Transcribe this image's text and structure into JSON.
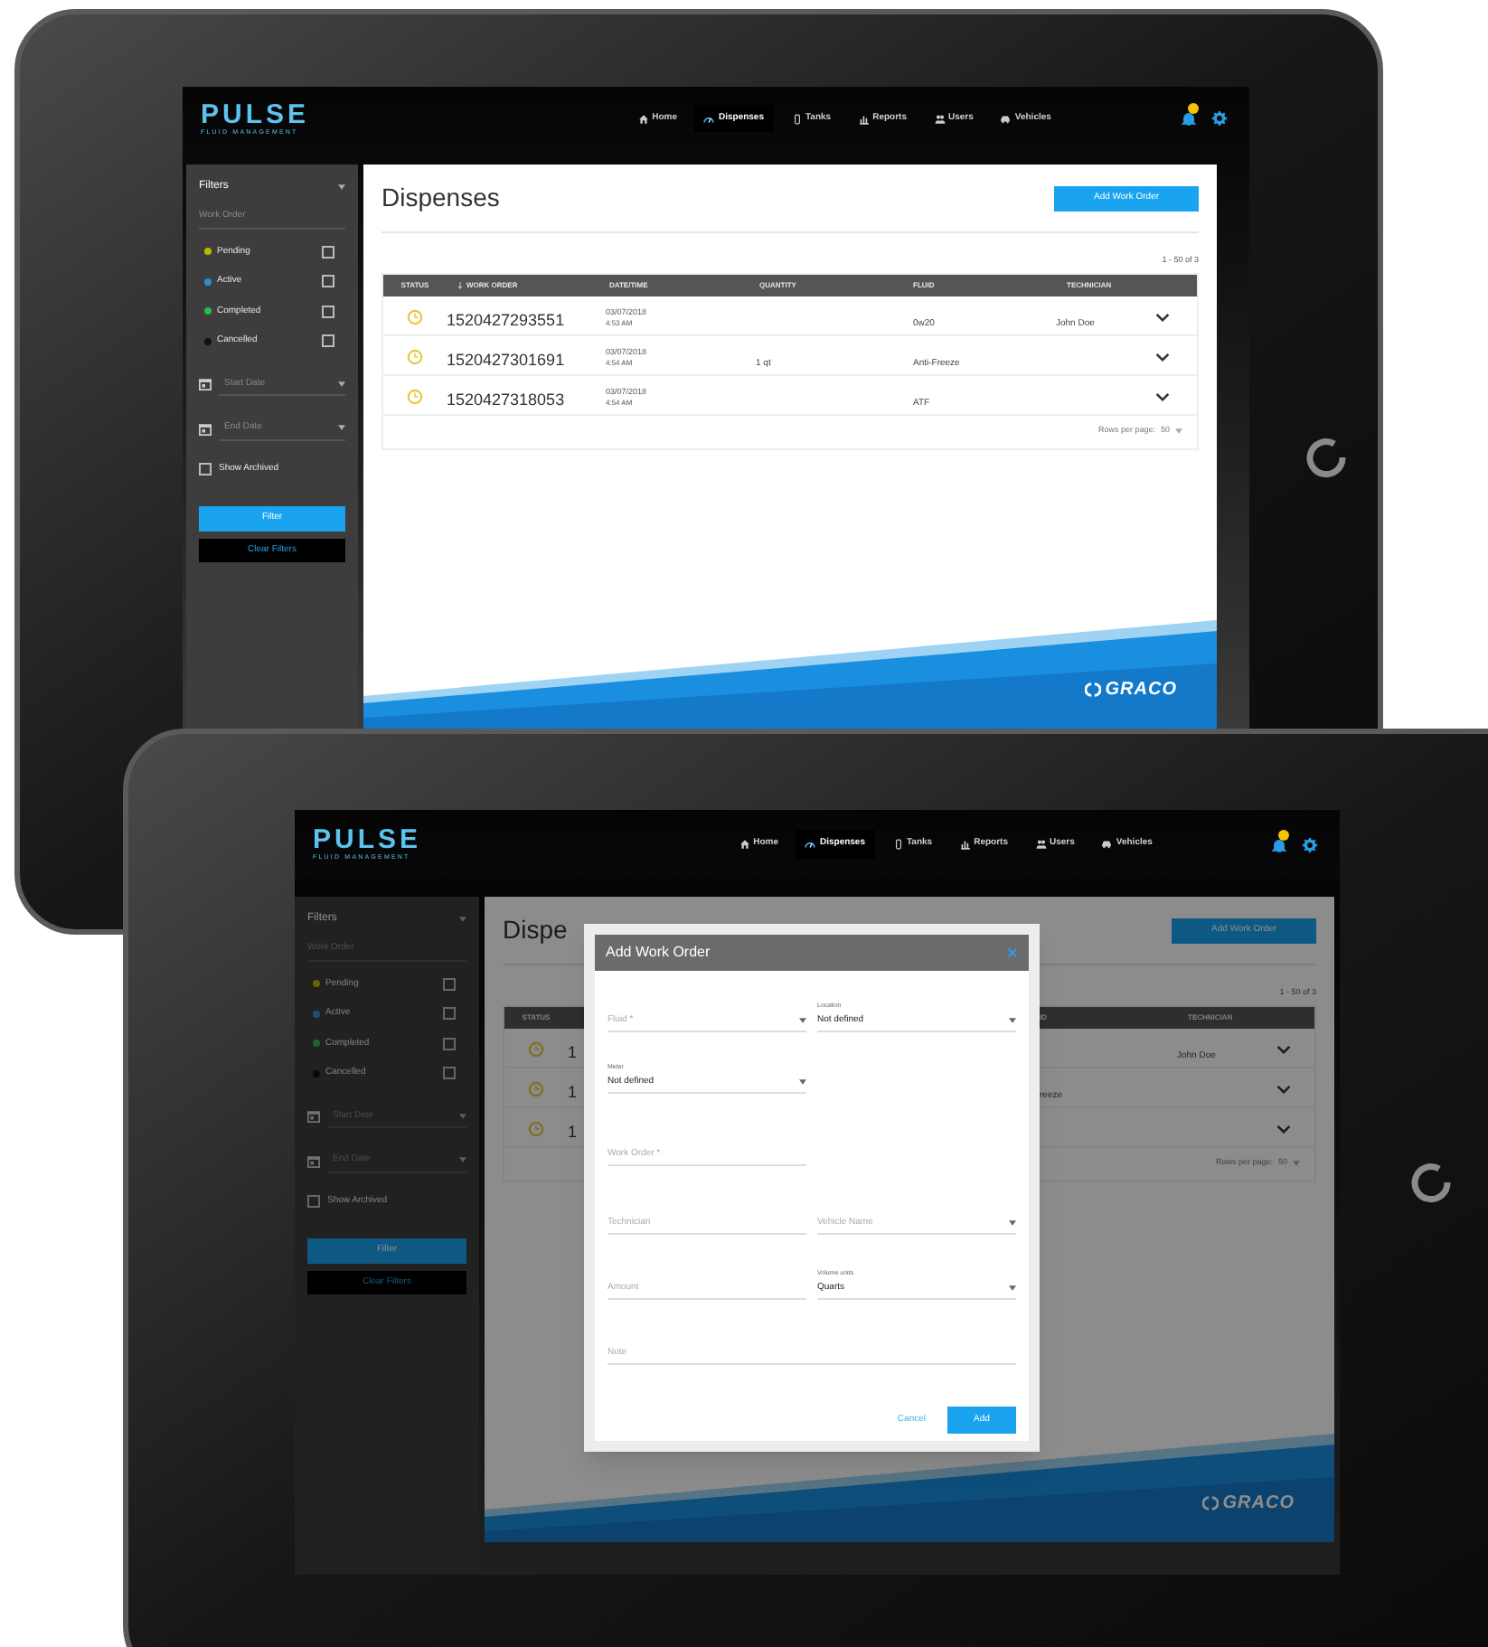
{
  "tablets": [
    {
      "screen": {
        "header": {
          "logo": "PULSE",
          "tagline": "FLUID MANAGEMENT",
          "nav": [
            {
              "label": "Home",
              "selected": false
            },
            {
              "label": "Dispenses",
              "selected": true
            },
            {
              "label": "Tanks",
              "selected": false
            },
            {
              "label": "Reports",
              "selected": false
            },
            {
              "label": "Users",
              "selected": false
            },
            {
              "label": "Vehicles",
              "selected": false
            }
          ]
        },
        "sidebar": {
          "title": "Filters",
          "search_placeholder": "Work Order",
          "statuses": [
            {
              "label": "Pending",
              "color": "#b8b800",
              "checked": false
            },
            {
              "label": "Active",
              "color": "#2a8fd6",
              "checked": false
            },
            {
              "label": "Completed",
              "color": "#2fb84a",
              "checked": false
            },
            {
              "label": "Cancelled",
              "color": "#111111",
              "checked": false
            }
          ],
          "start_date_placeholder": "Start Date",
          "end_date_placeholder": "End Date",
          "show_archived": {
            "label": "Show Archived",
            "checked": false
          },
          "filter_button": "Filter",
          "clear_button": "Clear Filters"
        },
        "page_title": "Dispenses",
        "add_button": "Add Work Order",
        "pagination": "1 - 50 of 3",
        "table": {
          "columns": [
            {
              "kind": "status",
              "label": "STATUS"
            },
            {
              "kind": "work_order",
              "label": "WORK ORDER"
            },
            {
              "kind": "date_time",
              "label": "DATE/TIME"
            },
            {
              "kind": "quantity",
              "label": "QUANTITY"
            },
            {
              "kind": "fluid",
              "label": "FLUID"
            },
            {
              "kind": "technician",
              "label": "TECHNICIAN"
            }
          ],
          "rows": [
            {
              "work_order": "1520427293551",
              "date": "03/07/2018",
              "time": "4:53 AM",
              "fluid": "0w20",
              "technician": "John Doe"
            },
            {
              "work_order": "1520427301691",
              "date": "03/07/2018",
              "time": "4:54 AM",
              "quantity": "1 qt",
              "fluid": "Anti-Freeze"
            },
            {
              "work_order": "1520427318053",
              "date": "03/07/2018",
              "time": "4:54 AM",
              "fluid": "ATF"
            }
          ]
        },
        "rows_per_page": {
          "label": "Rows per page:",
          "value": "50"
        },
        "brand": "GRACO"
      }
    },
    {
      "screen": {
        "header": {
          "logo": "PULSE",
          "tagline": "FLUID MANAGEMENT",
          "nav": [
            {
              "label": "Home",
              "selected": false
            },
            {
              "label": "Dispenses",
              "selected": true
            },
            {
              "label": "Tanks",
              "selected": false
            },
            {
              "label": "Reports",
              "selected": false
            },
            {
              "label": "Users",
              "selected": false
            },
            {
              "label": "Vehicles",
              "selected": false
            }
          ]
        },
        "sidebar": {
          "title": "Filters",
          "search_placeholder": "Work Order",
          "statuses": [
            {
              "label": "Pending",
              "color": "#656500",
              "checked": false
            },
            {
              "label": "Active",
              "color": "#174f76",
              "checked": false
            },
            {
              "label": "Completed",
              "color": "#1a6529",
              "checked": false
            },
            {
              "label": "Cancelled",
              "color": "#090909",
              "checked": false
            }
          ],
          "start_date_placeholder": "Start Date",
          "end_date_placeholder": "End Date",
          "show_archived": {
            "label": "Show Archived",
            "checked": false
          },
          "filter_button": "Filter",
          "clear_button": "Clear Filters"
        },
        "page_title": "Dispe",
        "add_button": "Add Work Order",
        "pagination": "1 - 50 of 3",
        "table": {
          "columns": [
            {
              "kind": "status",
              "label": "STATUS"
            },
            {
              "kind": "fluid",
              "label": "ID"
            },
            {
              "kind": "technician",
              "label": "TECHNICIAN"
            }
          ],
          "rows": [
            {
              "work_order": "1",
              "technician": "John Doe"
            },
            {
              "work_order": "1",
              "fluid": "reeze"
            },
            {
              "work_order": "1"
            }
          ]
        },
        "rows_per_page": {
          "label": "Rows per page:",
          "value": "50"
        },
        "brand": "GRACO",
        "modal": {
          "title": "Add Work Order",
          "field_rows": [
            {
              "fields": [
                {
                  "kind": "select",
                  "placeholder": "Fluid *"
                },
                {
                  "kind": "select",
                  "label": "Location",
                  "value": "Not defined"
                }
              ]
            },
            {
              "fields": [
                {
                  "kind": "select",
                  "label": "Meter",
                  "value": "Not defined"
                }
              ]
            },
            {
              "fields": [
                {
                  "kind": "text",
                  "placeholder": "Work Order *"
                }
              ]
            },
            {
              "fields": [
                {
                  "kind": "text",
                  "placeholder": "Technician"
                },
                {
                  "kind": "select",
                  "placeholder": "Vehicle Name"
                }
              ]
            },
            {
              "fields": [
                {
                  "kind": "text",
                  "placeholder": "Amount"
                },
                {
                  "kind": "select",
                  "label": "Volume units",
                  "value": "Quarts"
                }
              ]
            },
            {
              "fields": [
                {
                  "kind": "wide",
                  "placeholder": "Note"
                }
              ]
            }
          ],
          "cancel_button": "Cancel",
          "add_button": "Add"
        }
      }
    }
  ]
}
